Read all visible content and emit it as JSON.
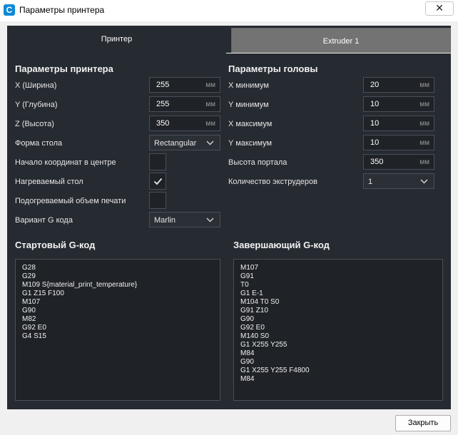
{
  "window": {
    "icon_letter": "C",
    "title": "Параметры принтера",
    "close_glyph": "✕"
  },
  "tabs": [
    {
      "label": "Принтер",
      "active": true
    },
    {
      "label": "Extruder 1",
      "active": false
    }
  ],
  "printer": {
    "heading": "Параметры принтера",
    "x_label": "X (Ширина)",
    "x_value": "255",
    "y_label": "Y (Глубина)",
    "y_value": "255",
    "z_label": "Z (Высота)",
    "z_value": "350",
    "shape_label": "Форма стола",
    "shape_value": "Rectangular",
    "origin_label": "Начало координат в центре",
    "origin_checked": false,
    "heated_bed_label": "Нагреваемый стол",
    "heated_bed_checked": true,
    "heated_volume_label": "Подогреваемый объем печати",
    "heated_volume_checked": false,
    "gcode_flavor_label": "Вариант G кода",
    "gcode_flavor_value": "Marlin"
  },
  "head": {
    "heading": "Параметры головы",
    "xmin_label": "X минимум",
    "xmin_value": "20",
    "ymin_label": "Y минимум",
    "ymin_value": "10",
    "xmax_label": "X максимум",
    "xmax_value": "10",
    "ymax_label": "Y максимум",
    "ymax_value": "10",
    "gantry_label": "Высота портала",
    "gantry_value": "350",
    "extruders_label": "Количество экструдеров",
    "extruders_value": "1"
  },
  "unit": "мм",
  "start_gcode": {
    "heading": "Стартовый G-код",
    "lines": [
      "G28",
      "G29",
      "M109 S{material_print_temperature}",
      "G1 Z15 F100",
      "M107",
      "G90",
      "M82",
      "G92 E0",
      "G4 S15"
    ]
  },
  "end_gcode": {
    "heading": "Завершающий G-код",
    "lines": [
      "M107",
      "G91",
      "T0",
      "G1 E-1",
      "M104 T0 S0",
      "G91 Z10",
      "G90",
      "G92 E0",
      "M140 S0",
      "G1 X255 Y255",
      "M84",
      "G90",
      "G1 X255 Y255 F4800",
      "M84"
    ]
  },
  "footer": {
    "close_label": "Закрыть"
  }
}
